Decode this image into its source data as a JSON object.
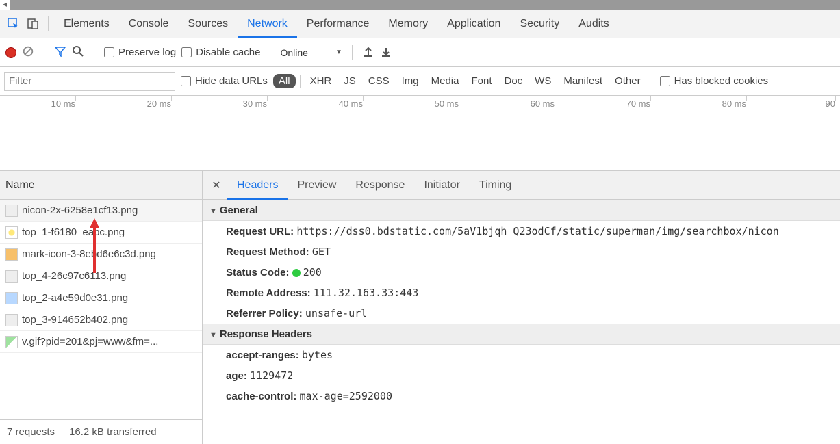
{
  "panel_tabs": [
    "Elements",
    "Console",
    "Sources",
    "Network",
    "Performance",
    "Memory",
    "Application",
    "Security",
    "Audits"
  ],
  "panel_active": "Network",
  "toolbar": {
    "preserve_log": "Preserve log",
    "disable_cache": "Disable cache",
    "throttling": "Online"
  },
  "filterbar": {
    "filter_placeholder": "Filter",
    "hide_data_urls": "Hide data URLs",
    "types": [
      "All",
      "XHR",
      "JS",
      "CSS",
      "Img",
      "Media",
      "Font",
      "Doc",
      "WS",
      "Manifest",
      "Other"
    ],
    "type_active": "All",
    "has_blocked_cookies": "Has blocked cookies"
  },
  "timeline_ticks": [
    "10 ms",
    "20 ms",
    "30 ms",
    "40 ms",
    "50 ms",
    "60 ms",
    "70 ms",
    "80 ms",
    "90"
  ],
  "requests_header": "Name",
  "requests": [
    {
      "name": "nicon-2x-6258e1cf13.png",
      "thumb": "gray",
      "selected": true
    },
    {
      "name": "top_1-f6180  eabc.png",
      "thumb": "yellow"
    },
    {
      "name": "mark-icon-3-8ebd6e6c3d.png",
      "thumb": "orange"
    },
    {
      "name": "top_4-26c97c6113.png",
      "thumb": "gray"
    },
    {
      "name": "top_2-a4e59d0e31.png",
      "thumb": "blue"
    },
    {
      "name": "top_3-914652b402.png",
      "thumb": "gray"
    },
    {
      "name": "v.gif?pid=201&pj=www&fm=...",
      "thumb": "green"
    }
  ],
  "status": {
    "requests": "7 requests",
    "transferred": "16.2 kB transferred"
  },
  "detail_tabs": [
    "Headers",
    "Preview",
    "Response",
    "Initiator",
    "Timing"
  ],
  "detail_active": "Headers",
  "headers": {
    "general_label": "General",
    "general": [
      {
        "k": "Request URL:",
        "v": "https://dss0.bdstatic.com/5aV1bjqh_Q23odCf/static/superman/img/searchbox/nicon",
        "mono": true
      },
      {
        "k": "Request Method:",
        "v": "GET",
        "mono": true
      },
      {
        "k": "Status Code:",
        "v": "200",
        "dot": true,
        "mono": true
      },
      {
        "k": "Remote Address:",
        "v": "111.32.163.33:443",
        "mono": true
      },
      {
        "k": "Referrer Policy:",
        "v": "unsafe-url",
        "mono": true
      }
    ],
    "response_headers_label": "Response Headers",
    "response_headers": [
      {
        "k": "accept-ranges:",
        "v": "bytes",
        "mono": true
      },
      {
        "k": "age:",
        "v": "1129472",
        "mono": true
      },
      {
        "k": "cache-control:",
        "v": "max-age=2592000",
        "mono": true
      }
    ]
  }
}
